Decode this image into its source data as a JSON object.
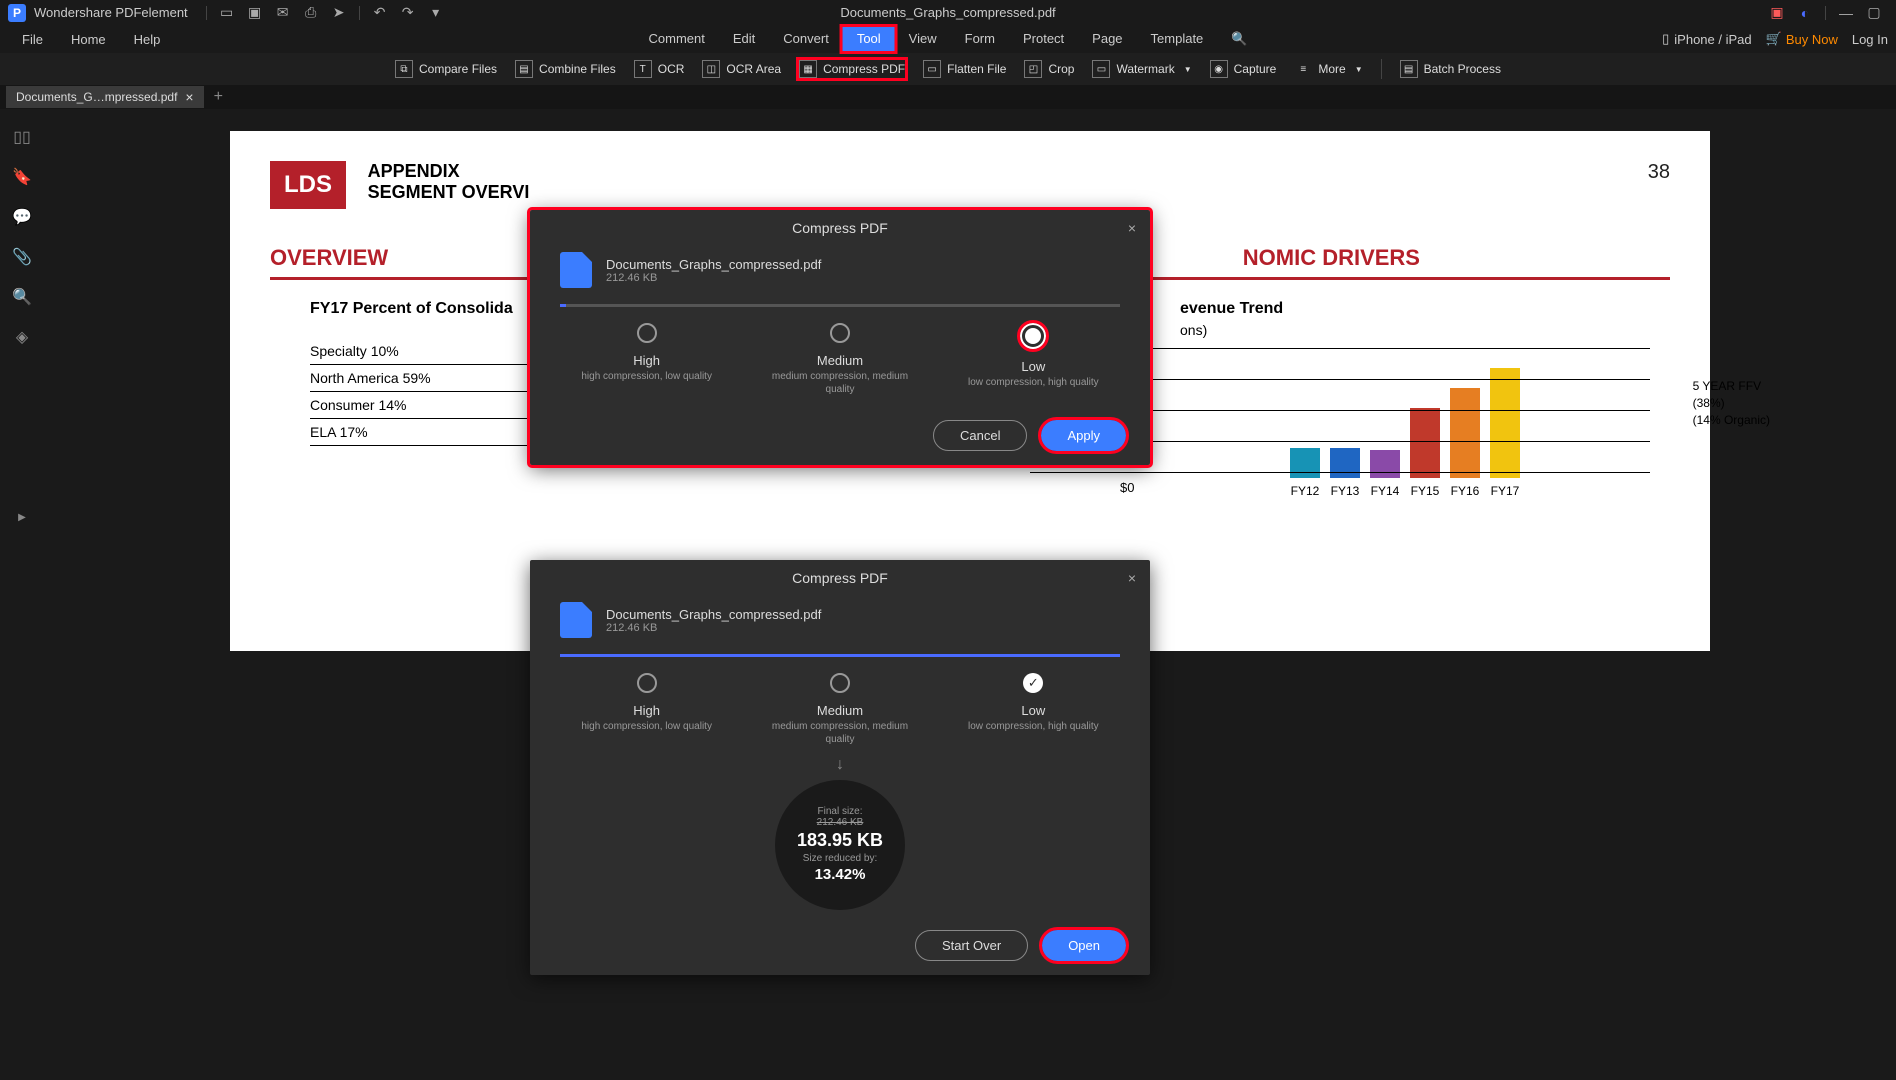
{
  "app": {
    "name": "Wondershare PDFelement",
    "doc_title": "Documents_Graphs_compressed.pdf"
  },
  "titlebar_icons": [
    "open",
    "save",
    "email",
    "print",
    "share",
    "undo",
    "redo",
    "more"
  ],
  "menu_left": [
    "File",
    "Home",
    "Help"
  ],
  "menu_center": [
    "Comment",
    "Edit",
    "Convert",
    "Tool",
    "View",
    "Form",
    "Protect",
    "Page",
    "Template"
  ],
  "menu_active": "Tool",
  "menu_right": {
    "device": "iPhone / iPad",
    "buy": "Buy Now",
    "login": "Log In"
  },
  "toolbar": [
    "Compare Files",
    "Combine Files",
    "OCR",
    "OCR Area",
    "Compress PDF",
    "Flatten File",
    "Crop",
    "Watermark",
    "Capture",
    "More",
    "Batch Process"
  ],
  "tab": {
    "label": "Documents_G…mpressed.pdf"
  },
  "page": {
    "lds": "LDS",
    "appendix": "APPENDIX",
    "segment": "SEGMENT OVERVI",
    "num": "38",
    "overview": "OVERVIEW",
    "drivers": "NOMIC DRIVERS",
    "sub1": "FY17 Percent of Consolida",
    "items": [
      "Specialty 10%",
      "North America 59%",
      "Consumer 14%",
      "ELA 17%"
    ],
    "rev": {
      "title": "evenue Trend",
      "sub": "ons)",
      "zero": "$0",
      "note1": "5 YEAR FFV",
      "note2": "(38%)",
      "note3": "(14% Organic)"
    }
  },
  "chart_data": {
    "type": "bar",
    "categories": [
      "FY12",
      "FY13",
      "FY14",
      "FY15",
      "FY16",
      "FY17"
    ],
    "values": [
      30,
      30,
      28,
      70,
      90,
      110
    ],
    "colors": [
      "#1793b5",
      "#1f66c2",
      "#8a4aa8",
      "#c0392b",
      "#e67e22",
      "#f1c40f"
    ],
    "ylim": [
      0,
      120
    ]
  },
  "dialog1": {
    "title": "Compress PDF",
    "file": "Documents_Graphs_compressed.pdf",
    "size": "212.46 KB",
    "opts": [
      {
        "name": "High",
        "desc": "high compression, low quality"
      },
      {
        "name": "Medium",
        "desc": "medium compression, medium quality"
      },
      {
        "name": "Low",
        "desc": "low compression, high quality"
      }
    ],
    "cancel": "Cancel",
    "apply": "Apply"
  },
  "dialog2": {
    "title": "Compress PDF",
    "file": "Documents_Graphs_compressed.pdf",
    "size": "212.46 KB",
    "opts": [
      {
        "name": "High",
        "desc": "high compression, low quality"
      },
      {
        "name": "Medium",
        "desc": "medium compression, medium quality"
      },
      {
        "name": "Low",
        "desc": "low compression, high quality"
      }
    ],
    "final_label": "Final size:",
    "old": "212.46 KB",
    "new": "183.95 KB",
    "reduced_label": "Size reduced by:",
    "pct": "13.42%",
    "startover": "Start Over",
    "open": "Open"
  }
}
